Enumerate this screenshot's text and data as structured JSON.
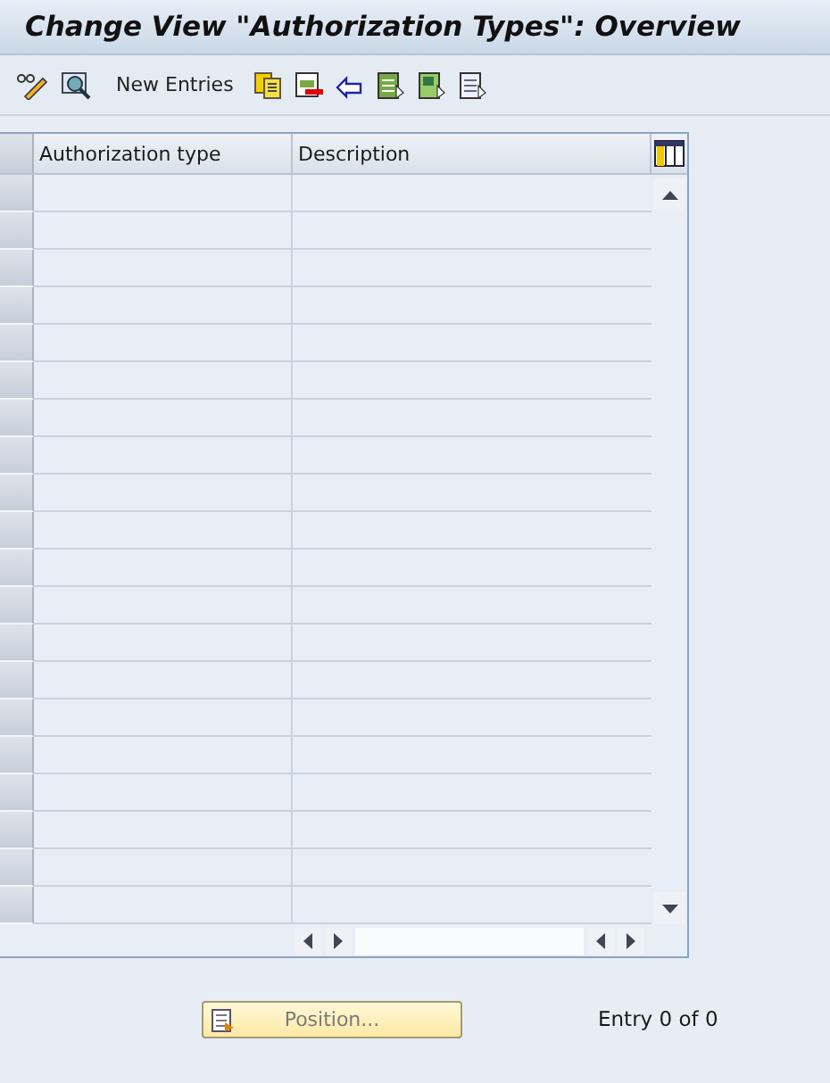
{
  "window": {
    "title": "Change View \"Authorization Types\": Overview"
  },
  "toolbar": {
    "new_entries": "New Entries"
  },
  "table": {
    "columns": [
      "Authorization type",
      "Description"
    ]
  },
  "footer": {
    "position_button": {
      "label": "Position...",
      "disabled": true
    },
    "entry_count": "Entry 0 of 0"
  }
}
